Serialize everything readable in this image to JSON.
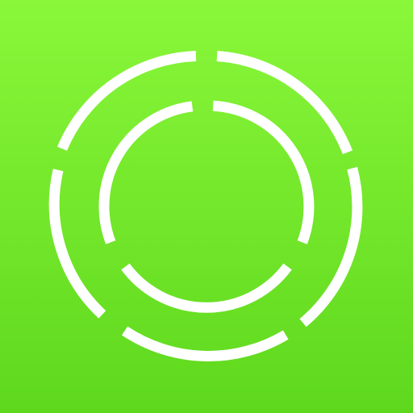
{
  "icon": {
    "name": "segmented-rings-icon",
    "colors": {
      "background_top": "#8af73a",
      "background_bottom": "#5ed81d",
      "ring": "#ffffff"
    }
  }
}
